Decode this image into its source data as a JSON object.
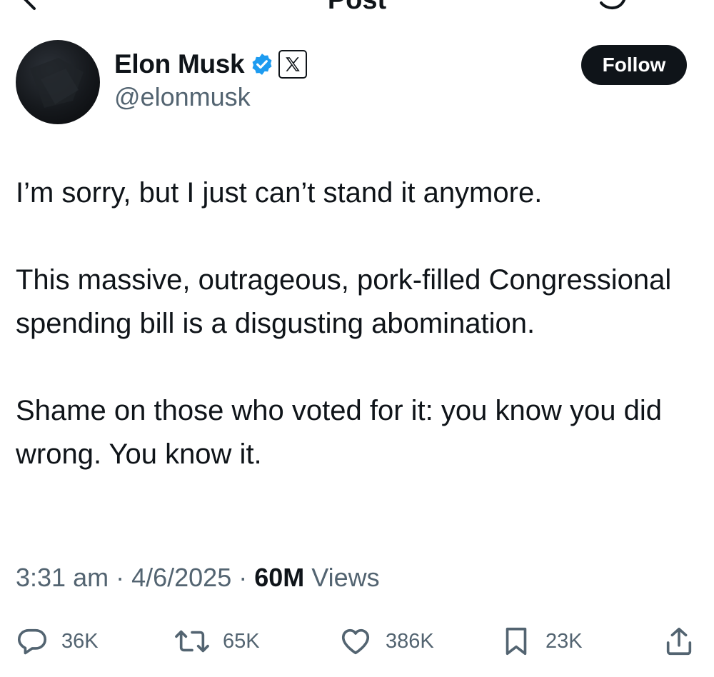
{
  "header": {
    "title": "Post"
  },
  "author": {
    "display_name": "Elon Musk",
    "handle": "@elonmusk",
    "verified": true,
    "affiliate": "X"
  },
  "follow_label": "Follow",
  "tweet": {
    "paragraphs": [
      "I’m sorry, but I just can’t stand it anymore.",
      "This massive, outrageous, pork-filled Congressional spending bill is a disgusting abomination.",
      "Shame on those who voted for it: you know you did wrong. You know it."
    ]
  },
  "meta": {
    "time": "3:31 am",
    "separator": "·",
    "date": "4/6/2025",
    "views_count": "60M",
    "views_label": "Views"
  },
  "actions": {
    "replies": "36K",
    "reposts": "65K",
    "likes": "386K",
    "bookmarks": "23K"
  },
  "colors": {
    "text": "#0f1419",
    "secondary": "#536471",
    "verified": "#1d9bf0"
  },
  "icons": [
    "back-arrow-icon",
    "verified-badge-icon",
    "x-logo-icon",
    "reply-icon",
    "repost-icon",
    "like-icon",
    "bookmark-icon",
    "share-icon"
  ]
}
